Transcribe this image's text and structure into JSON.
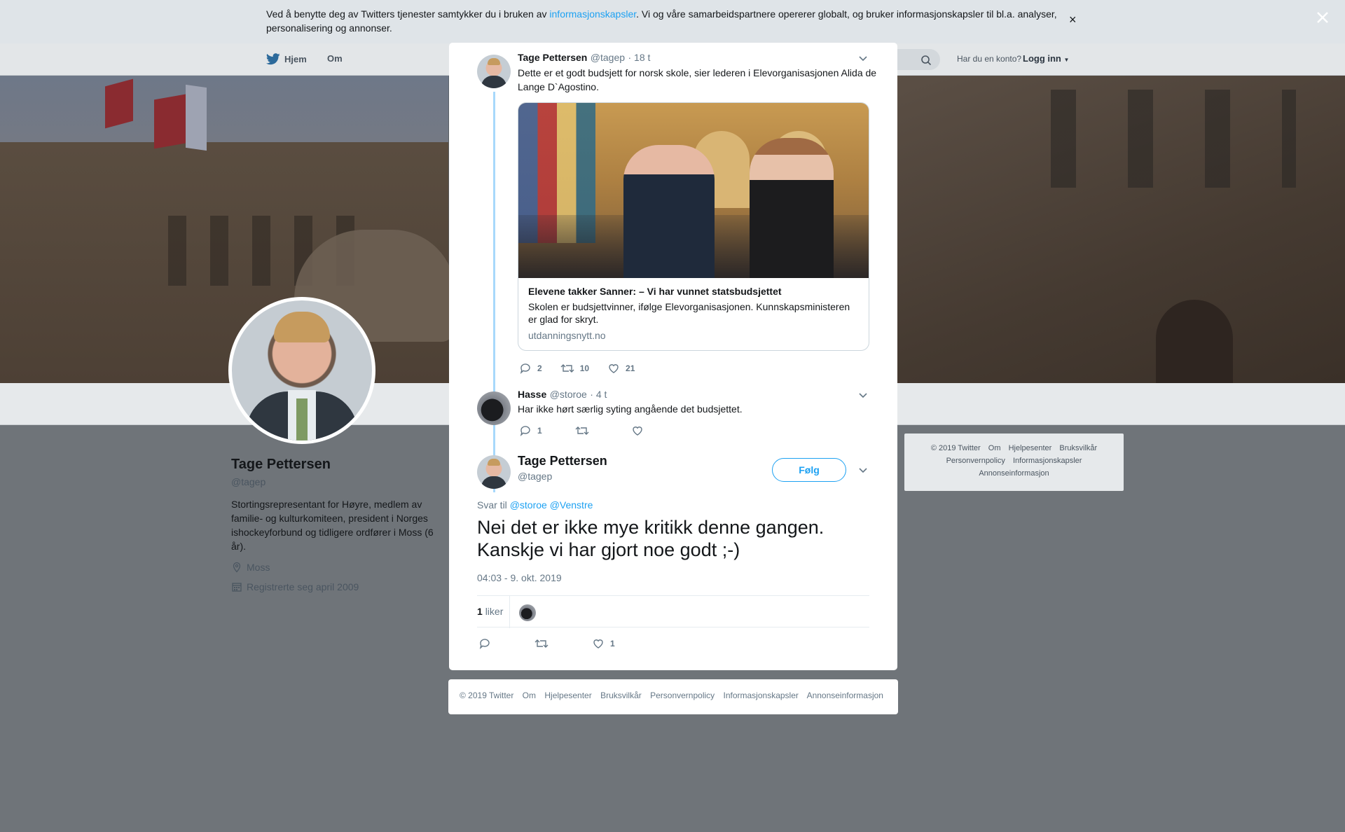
{
  "cookie_bar": {
    "text_before": "Ved å benytte deg av Twitters tjenester samtykker du i bruken av ",
    "link": "informasjonskapsler",
    "text_after": ". Vi og våre samarbeidspartnere opererer globalt, og bruker informasjonskapsler til bl.a. analyser, personalisering og annonser.",
    "close": "×"
  },
  "nav": {
    "home": "Hjem",
    "about": "Om",
    "account_question": "Har du en konto?",
    "login": "Logg inn"
  },
  "profile": {
    "name": "Tage Pettersen",
    "handle": "@tagep",
    "bio": "Stortingsrepresentant for Høyre, medlem av familie- og kulturkomiteen, president i Norges ishockeyforbund og tidligere ordfører i Moss (6 år).",
    "location": "Moss",
    "joined": "Registrerte seg april 2009"
  },
  "side_footer": {
    "copyright": "© 2019 Twitter",
    "links": [
      "Om",
      "Hjelpesenter",
      "Bruksvilkår",
      "Personvernpolicy",
      "Informasjonskapsler",
      "Annonseinformasjon"
    ]
  },
  "tweet1": {
    "name": "Tage Pettersen",
    "handle": "@tagep",
    "time": "· 18 t",
    "text": "Dette er et godt budsjett for norsk skole, sier lederen i Elevorganisasjonen Alida de Lange D`Agostino.",
    "card": {
      "title": "Elevene takker Sanner: – Vi har vunnet statsbudsjettet",
      "description": "Skolen er budsjettvinner, ifølge Elevorganisasjonen. Kunnskapsministeren er glad for skryt.",
      "domain": "utdanningsnytt.no"
    },
    "replies": "2",
    "retweets": "10",
    "likes": "21"
  },
  "tweet2": {
    "name": "Hasse",
    "handle": "@storoe",
    "time": "· 4 t",
    "text": "Har ikke hørt særlig syting angående det budsjettet.",
    "replies": "1",
    "retweets": "",
    "likes": ""
  },
  "focus_tweet": {
    "name": "Tage Pettersen",
    "handle": "@tagep",
    "follow": "Følg",
    "reply_to_label": "Svar til",
    "reply_to_1": "@storoe",
    "reply_to_2": "@Venstre",
    "text": "Nei det er ikke mye kritikk denne gangen. Kanskje vi har gjort noe godt ;-)",
    "timestamp": "04:03 - 9. okt. 2019",
    "like_count": "1",
    "like_label": "liker",
    "likes": "1"
  },
  "modal_footer": {
    "copyright": "© 2019 Twitter",
    "links": [
      "Om",
      "Hjelpesenter",
      "Bruksvilkår",
      "Personvernpolicy",
      "Informasjonskapsler",
      "Annonseinformasjon"
    ]
  },
  "colors": {
    "accent": "#1da1f2",
    "text": "#14171a",
    "muted": "#657786",
    "overlay": "#6f7479"
  }
}
